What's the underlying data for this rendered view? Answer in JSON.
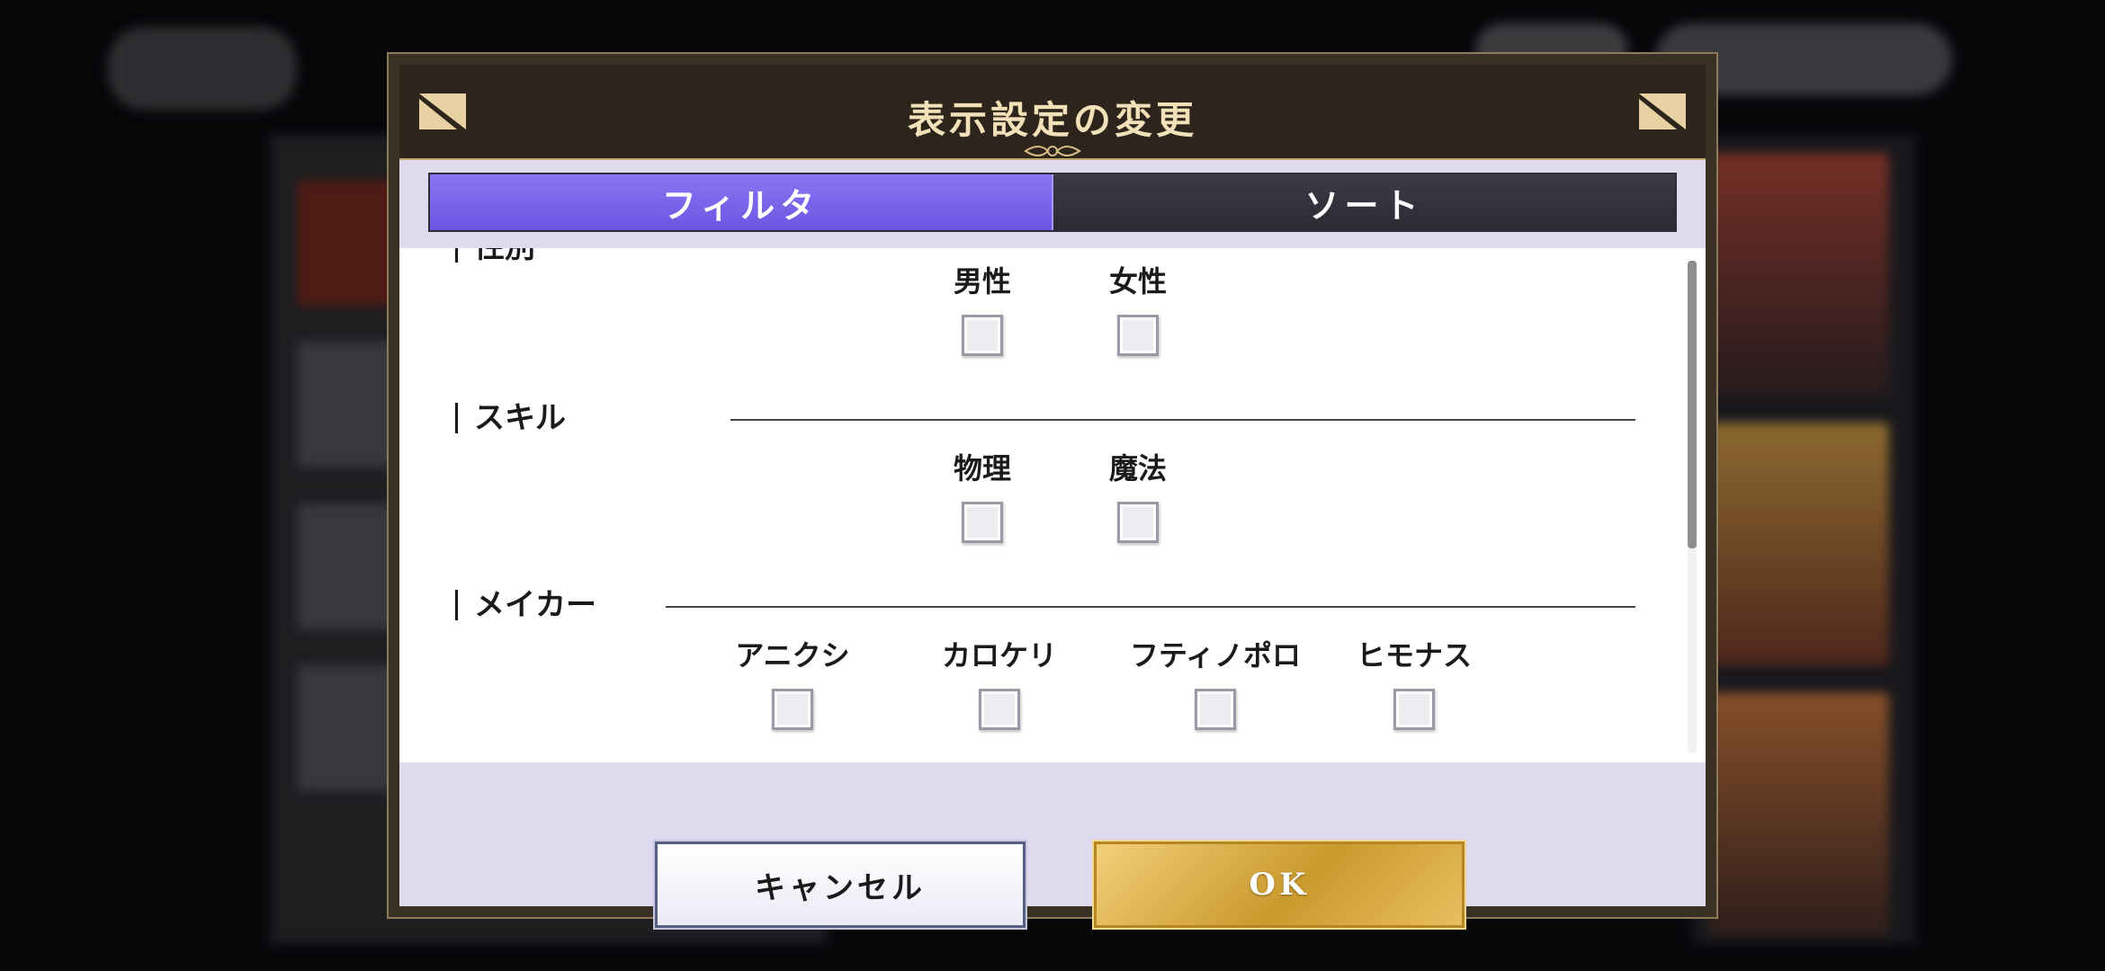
{
  "dialog": {
    "title": "表示設定の変更",
    "tabs": [
      {
        "label": "フィルタ",
        "active": true
      },
      {
        "label": "ソート",
        "active": false
      }
    ],
    "sections": {
      "partial_title": "性別",
      "gender_options": [
        "男性",
        "女性"
      ],
      "skill_title": "スキル",
      "skill_options": [
        "物理",
        "魔法"
      ],
      "maker_title": "メイカー",
      "maker_options": [
        "アニクシ",
        "カロケリ",
        "フティノポロ",
        "ヒモナス"
      ]
    },
    "buttons": {
      "cancel": "キャンセル",
      "ok": "OK"
    }
  },
  "colors": {
    "tab_active": "#7a63ea",
    "tab_inactive": "#34343e",
    "dialog_frame": "#3a3024",
    "body_bg": "#dfdbef",
    "ok_gold": "#d9aa44"
  }
}
